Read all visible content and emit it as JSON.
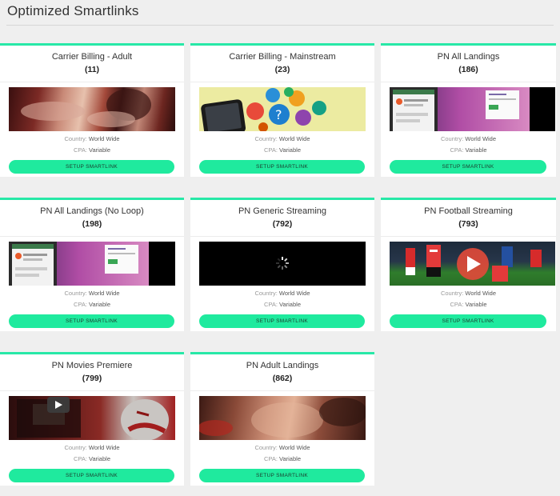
{
  "page": {
    "title": "Optimized Smartlinks"
  },
  "labels": {
    "country_prefix": "Country:",
    "cpa_prefix": "CPA:",
    "button": "SETUP SMARTLINK"
  },
  "accent_color": "#27e8a7",
  "cards": [
    {
      "title": "Carrier Billing - Adult",
      "count": "(11)",
      "country": "World Wide",
      "cpa": "Variable",
      "thumb": "adult-photo"
    },
    {
      "title": "Carrier Billing - Mainstream",
      "count": "(23)",
      "country": "World Wide",
      "cpa": "Variable",
      "thumb": "app-icons-phone"
    },
    {
      "title": "PN All Landings",
      "count": "(186)",
      "country": "World Wide",
      "cpa": "Variable",
      "thumb": "landing-page-screenshot"
    },
    {
      "title": "PN All Landings (No Loop)",
      "count": "(198)",
      "country": "World Wide",
      "cpa": "Variable",
      "thumb": "landing-page-screenshot"
    },
    {
      "title": "PN Generic Streaming",
      "count": "(792)",
      "country": "World Wide",
      "cpa": "Variable",
      "thumb": "loading-spinner"
    },
    {
      "title": "PN Football Streaming",
      "count": "(793)",
      "country": "World Wide",
      "cpa": "Variable",
      "thumb": "football-play"
    },
    {
      "title": "PN Movies Premiere",
      "count": "(799)",
      "country": "World Wide",
      "cpa": "Variable",
      "thumb": "movie-play"
    },
    {
      "title": "PN Adult Landings",
      "count": "(862)",
      "country": "World Wide",
      "cpa": "Variable",
      "thumb": "adult-photo"
    }
  ]
}
